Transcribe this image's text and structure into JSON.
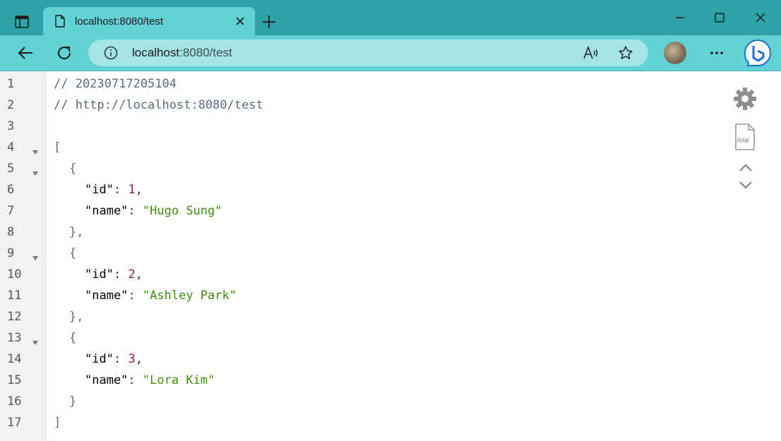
{
  "browser": {
    "tab_title": "localhost:8080/test",
    "url_host": "localhost",
    "url_path": ":8080/test"
  },
  "json_view": {
    "line_numbers": [
      "1",
      "2",
      "3",
      "4",
      "5",
      "6",
      "7",
      "8",
      "9",
      "10",
      "11",
      "12",
      "13",
      "14",
      "15",
      "16",
      "17"
    ],
    "comment_timestamp": "// 20230717205104",
    "comment_url": "// http://localhost:8080/test",
    "open_array": "[",
    "close_array": "]",
    "open_obj": "{",
    "close_obj_comma": "},",
    "close_obj": "}",
    "key_id": "\"id\"",
    "key_name": "\"name\"",
    "colon": ": ",
    "comma": ",",
    "records": [
      {
        "id": "1",
        "name": "\"Hugo Sung\""
      },
      {
        "id": "2",
        "name": "\"Ashley Park\""
      },
      {
        "id": "3",
        "name": "\"Lora Kim\""
      }
    ],
    "raw_label": "RAW"
  },
  "colors": {
    "titlebar": "#2ea2a6",
    "toolbar": "#62d2d6",
    "addressbar": "#a6e5e7",
    "json_string": "#3d8e0a",
    "json_number": "#8b1a56"
  },
  "icons": [
    "tab-actions-icon",
    "page-icon",
    "close-icon",
    "plus-icon",
    "minimize-icon",
    "maximize-icon",
    "window-close-icon",
    "back-arrow-icon",
    "refresh-icon",
    "info-icon",
    "read-aloud-icon",
    "favorite-star-icon",
    "profile-avatar",
    "more-dots-icon",
    "bing-icon",
    "gear-icon",
    "raw-file-icon",
    "chevron-up-icon",
    "chevron-down-icon"
  ]
}
